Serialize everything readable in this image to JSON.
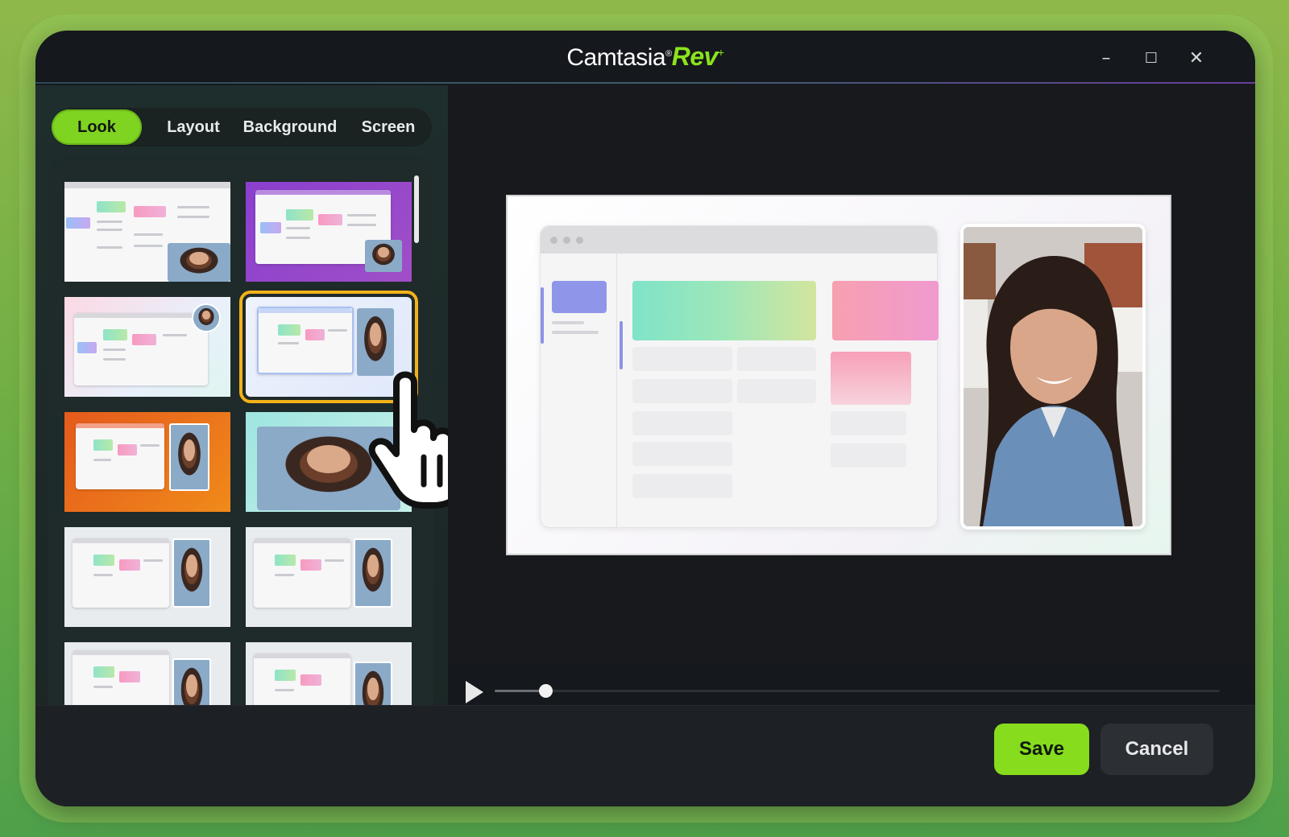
{
  "app": {
    "logo_main": "Camtasia",
    "logo_reg": "®",
    "logo_accent": "Rev",
    "logo_star": "+",
    "accent_color": "#86dc1d"
  },
  "window_controls": {
    "minimize_icon": "minimize-icon",
    "maximize_icon": "maximize-icon",
    "close_icon": "close-icon",
    "minimize_glyph": "–",
    "maximize_glyph": "☐",
    "close_glyph": "✕"
  },
  "tabs": [
    {
      "label": "Look",
      "active": true
    },
    {
      "label": "Layout",
      "active": false
    },
    {
      "label": "Background",
      "active": false
    },
    {
      "label": "Screen",
      "active": false
    }
  ],
  "thumbnails": [
    {
      "style": "plain-gray",
      "selected": false
    },
    {
      "style": "purple",
      "selected": false
    },
    {
      "style": "pastel-pink-round-cam",
      "selected": false
    },
    {
      "style": "blue-soft",
      "selected": true
    },
    {
      "style": "orange",
      "selected": false
    },
    {
      "style": "teal-camera-only",
      "selected": false
    },
    {
      "style": "light-gray-1",
      "selected": false
    },
    {
      "style": "light-gray-2",
      "selected": false
    },
    {
      "style": "photo-bg",
      "selected": false
    },
    {
      "style": "light-gray-3",
      "selected": false
    }
  ],
  "player": {
    "play_icon": "play-icon",
    "progress_fraction": 0.07
  },
  "footer": {
    "save_label": "Save",
    "cancel_label": "Cancel"
  }
}
